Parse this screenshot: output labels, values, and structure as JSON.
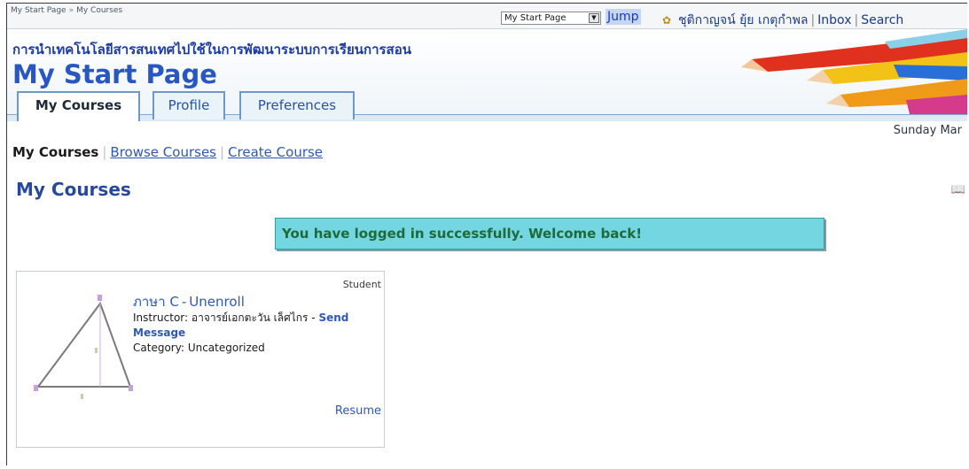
{
  "topbar": {
    "breadcrumb": [
      "My Start Page",
      "My Courses"
    ],
    "breadcrumb_sep": "»",
    "jump_select": "My Start Page",
    "jump_button": "Jump",
    "user_name": "ชุติกาญจน์ ยุ้ย เกตุกำพล",
    "inbox": "Inbox",
    "search": "Search"
  },
  "banner": {
    "subtitle": "การนำเทคโนโลยีสารสนเทศไปใช้ในการพัฒนาระบบการเรียนการสอน",
    "title": "My Start Page"
  },
  "tabs": [
    {
      "label": "My Courses",
      "active": true
    },
    {
      "label": "Profile",
      "active": false
    },
    {
      "label": "Preferences",
      "active": false
    }
  ],
  "date_text": "Sunday Mar",
  "subnav": {
    "current": "My Courses",
    "links": [
      "Browse Courses",
      "Create Course"
    ]
  },
  "heading": "My Courses",
  "notice": "You have logged in successfully. Welcome back!",
  "course": {
    "role": "Student",
    "name": "ภาษา C",
    "separator": "-",
    "unenroll": "Unenroll",
    "instructor_label": "Instructor:",
    "instructor_name": "อาจารย์เอกตะวัน เล็ศไกร",
    "send_message": "Send Message",
    "category_label": "Category:",
    "category_value": "Uncategorized",
    "resume": "Resume"
  },
  "colors": {
    "title_blue": "#2856c2",
    "link_blue": "#2d58b8",
    "notice_bg": "#74d6e0",
    "notice_text": "#1d6a3a",
    "tab_border": "#6e98c7"
  },
  "icons": {
    "user": "user-icon",
    "select_arrow": "chevron-down-icon",
    "book": "book-icon"
  }
}
